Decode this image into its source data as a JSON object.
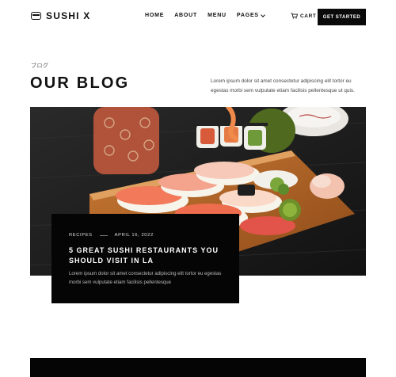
{
  "brand": {
    "name": "SUSHI X"
  },
  "nav": {
    "items": [
      "HOME",
      "ABOUT",
      "MENU",
      "PAGES"
    ],
    "cart_label": "CART",
    "cta_label": "GET STARTED"
  },
  "blog": {
    "eyebrow": "ブログ",
    "title": "OUR BLOG",
    "intro": "Lorem ipsum dolor sit amet consectetur adipiscing elit tortor eu egestas morbi sem vulputate etiam facilisis pellentesque ut quis."
  },
  "featured_post": {
    "category": "RECIPES",
    "date": "APRIL 16, 2022",
    "title": "5 GREAT SUSHI RESTAURANTS YOU SHOULD VISIT IN LA",
    "excerpt": "Lorem ipsum dolor sit amet consectetur adipiscing elit tortor eu egestas morbi sem vulputate etiam facilisis pellentesque",
    "image": "sushi platter on wooden board with teacup and green tea cup"
  },
  "icons": {
    "logo": "sushi-roll-icon",
    "cart": "cart-icon",
    "dropdown": "chevron-down-icon"
  },
  "colors": {
    "primary": "#0a0a0a",
    "background": "#ffffff",
    "text_muted": "#444444"
  }
}
